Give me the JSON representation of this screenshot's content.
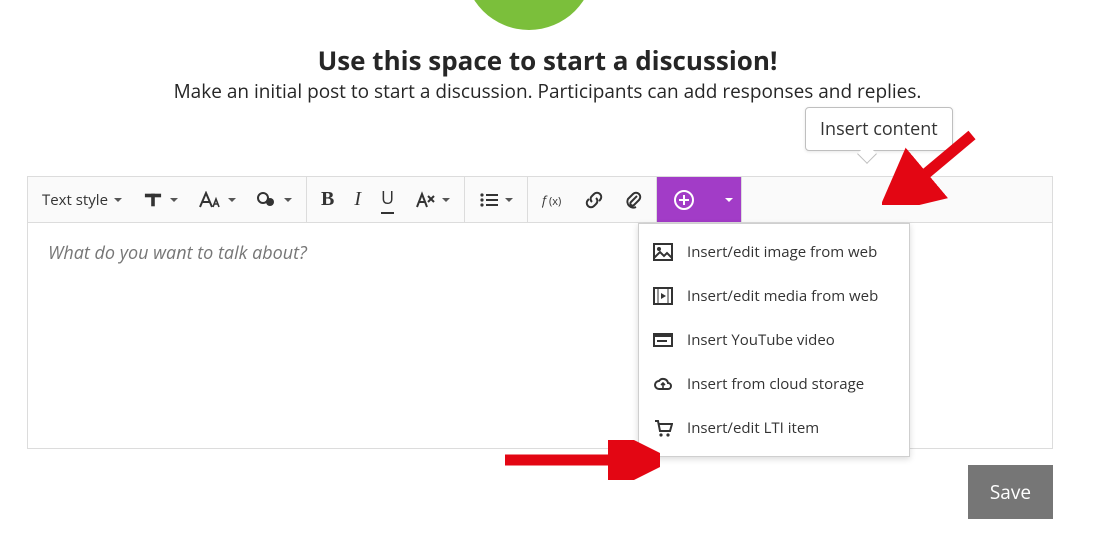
{
  "header": {
    "title": "Use this space to start a discussion!",
    "subtitle": "Make an initial post to start a discussion. Participants can add responses and replies."
  },
  "tooltip": "Insert content",
  "toolbar": {
    "text_style": "Text style"
  },
  "editor": {
    "placeholder": "What do you want to talk about?"
  },
  "dropdown": {
    "items": [
      {
        "label": "Insert/edit image from web"
      },
      {
        "label": "Insert/edit media from web"
      },
      {
        "label": "Insert YouTube video"
      },
      {
        "label": "Insert from cloud storage"
      },
      {
        "label": "Insert/edit LTI item"
      }
    ]
  },
  "buttons": {
    "save": "Save"
  },
  "colors": {
    "accent": "#A23CC7",
    "avatar": "#7BBF3B",
    "annotation_arrow": "#E30613"
  }
}
